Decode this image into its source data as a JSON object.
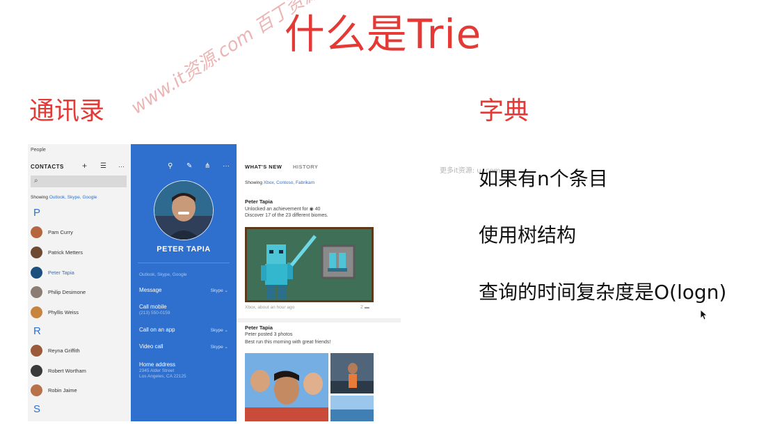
{
  "slide": {
    "title": "什么是Trie",
    "left_heading": "通讯录",
    "right_heading": "字典",
    "bullets": [
      "如果有n个条目",
      "使用树结构",
      "查询的时间复杂度是O(logn)"
    ]
  },
  "colors": {
    "accent_red": "#e53935",
    "people_blue": "#2f6fcd"
  },
  "watermark": {
    "text": "www.it资源.com 百丁资源随心下",
    "small_text": "更多it资源: u .com"
  },
  "people_app": {
    "app_name": "People",
    "contacts_header": "CONTACTS",
    "header_icons": [
      "add-icon",
      "list-icon",
      "more-icon"
    ],
    "showing_prefix": "Showing",
    "showing_sources": "Outlook, Skype, Google",
    "groups": [
      {
        "letter": "P",
        "contacts": [
          "Pam Curry",
          "Patrick Metters",
          "Peter Tapia",
          "Philip Desimone",
          "Phyllis Weiss"
        ]
      },
      {
        "letter": "R",
        "contacts": [
          "Reyna Griffith",
          "Robert Wortham",
          "Robin Jaime"
        ]
      },
      {
        "letter": "S",
        "contacts": []
      }
    ],
    "selected_contact": "Peter Tapia",
    "profile": {
      "toolbar_icons": [
        "pin-icon",
        "edit-icon",
        "share-icon",
        "more-icon"
      ],
      "name": "PETER TAPIA",
      "sources": "Outlook, Skype, Google",
      "actions": [
        {
          "label": "Message",
          "detail": "",
          "right": "Skype ⌄"
        },
        {
          "label": "Call mobile",
          "detail": "(213) 550-0159",
          "right": ""
        },
        {
          "label": "Call on an app",
          "detail": "",
          "right": "Skype ⌄"
        },
        {
          "label": "Video call",
          "detail": "",
          "right": "Skype ⌄"
        },
        {
          "label": "Home address",
          "detail": "2345 Alder Street",
          "detail2": "Los Angeles, CA 22125",
          "right": ""
        }
      ]
    },
    "feed": {
      "tabs": [
        "WHAT'S NEW",
        "HISTORY"
      ],
      "showing_prefix": "Showing",
      "showing_sources": "Xbox, Contoso, Fabrikam",
      "posts": [
        {
          "name": "Peter Tapia",
          "headline": "Unlocked an achievement for ◉ 40",
          "body": "Discover 17 of the 23 different biomes.",
          "meta": "Xbox, about an hour ago",
          "count": "2"
        },
        {
          "name": "Peter Tapia",
          "headline": "Peter posted 3 photos",
          "body": "Best run this morning with great friends!"
        }
      ]
    }
  }
}
